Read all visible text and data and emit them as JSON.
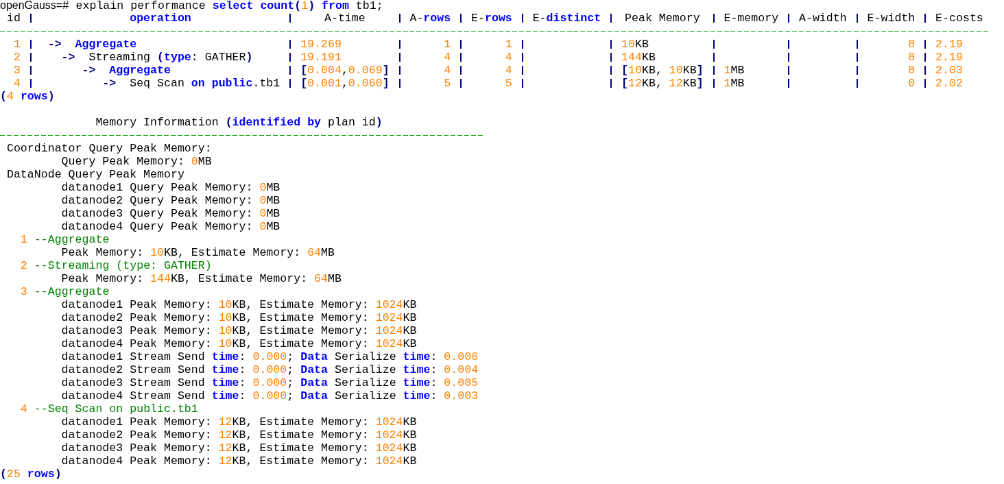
{
  "prompt": {
    "segments": [
      {
        "text": "openGauss=# ",
        "kind": "prompt"
      },
      {
        "text": "explain performance ",
        "kind": "plain"
      },
      {
        "text": "select count",
        "kind": "keyword"
      },
      {
        "text": "(",
        "kind": "operator"
      },
      {
        "text": "1",
        "kind": "number"
      },
      {
        "text": ")",
        "kind": "operator"
      },
      {
        "text": " from",
        "kind": "keyword"
      },
      {
        "text": " tb1;",
        "kind": "plain"
      }
    ]
  },
  "table": {
    "columns": [
      {
        "kind": "numeric",
        "header": [
          {
            "text": "id",
            "kind": "plain"
          }
        ]
      },
      {
        "kind": "text",
        "header": [
          {
            "text": "operation",
            "kind": "keyword"
          }
        ]
      },
      {
        "kind": "text",
        "header": [
          {
            "text": "A-time",
            "kind": "plain"
          }
        ]
      },
      {
        "kind": "numeric",
        "header": [
          {
            "text": "A-",
            "kind": "plain"
          },
          {
            "text": "rows",
            "kind": "keyword"
          }
        ]
      },
      {
        "kind": "numeric",
        "header": [
          {
            "text": "E-",
            "kind": "plain"
          },
          {
            "text": "rows",
            "kind": "keyword"
          }
        ]
      },
      {
        "kind": "numeric",
        "header": [
          {
            "text": "E-",
            "kind": "plain"
          },
          {
            "text": "distinct",
            "kind": "keyword"
          }
        ]
      },
      {
        "kind": "text",
        "header": [
          {
            "text": "Peak Memory",
            "kind": "plain"
          }
        ]
      },
      {
        "kind": "text",
        "header": [
          {
            "text": "E-memory",
            "kind": "plain"
          }
        ]
      },
      {
        "kind": "numeric",
        "header": [
          {
            "text": "A-width",
            "kind": "plain"
          }
        ]
      },
      {
        "kind": "numeric",
        "header": [
          {
            "text": "E-width",
            "kind": "plain"
          }
        ]
      },
      {
        "kind": "text",
        "header": [
          {
            "text": "E-costs",
            "kind": "plain"
          }
        ]
      }
    ],
    "rows": [
      {
        "cells": [
          [
            {
              "text": "1",
              "kind": "number"
            }
          ],
          [
            {
              "text": " ->",
              "kind": "operator"
            },
            {
              "text": "  Aggregate",
              "kind": "keyword"
            }
          ],
          [
            {
              "text": "19.269",
              "kind": "number"
            }
          ],
          [
            {
              "text": "1",
              "kind": "number"
            }
          ],
          [
            {
              "text": "1",
              "kind": "number"
            }
          ],
          null,
          [
            {
              "text": "10",
              "kind": "number"
            },
            {
              "text": "KB",
              "kind": "plain"
            }
          ],
          null,
          null,
          [
            {
              "text": "8",
              "kind": "number"
            }
          ],
          [
            {
              "text": "2.19",
              "kind": "number"
            }
          ]
        ]
      },
      {
        "cells": [
          [
            {
              "text": "2",
              "kind": "number"
            }
          ],
          [
            {
              "text": "   ->",
              "kind": "operator"
            },
            {
              "text": "  Streaming ",
              "kind": "plain"
            },
            {
              "text": "(",
              "kind": "operator"
            },
            {
              "text": "type",
              "kind": "keyword"
            },
            {
              "text": ": GATHER",
              "kind": "plain"
            },
            {
              "text": ")",
              "kind": "operator"
            }
          ],
          [
            {
              "text": "19.191",
              "kind": "number"
            }
          ],
          [
            {
              "text": "4",
              "kind": "number"
            }
          ],
          [
            {
              "text": "4",
              "kind": "number"
            }
          ],
          null,
          [
            {
              "text": "144",
              "kind": "number"
            },
            {
              "text": "KB",
              "kind": "plain"
            }
          ],
          null,
          null,
          [
            {
              "text": "8",
              "kind": "number"
            }
          ],
          [
            {
              "text": "2.19",
              "kind": "number"
            }
          ]
        ]
      },
      {
        "cells": [
          [
            {
              "text": "3",
              "kind": "number"
            }
          ],
          [
            {
              "text": "      ->",
              "kind": "operator"
            },
            {
              "text": "  Aggregate",
              "kind": "keyword"
            }
          ],
          [
            {
              "text": "[",
              "kind": "operator"
            },
            {
              "text": "0.004",
              "kind": "number"
            },
            {
              "text": ",",
              "kind": "plain"
            },
            {
              "text": "0.069",
              "kind": "number"
            },
            {
              "text": "]",
              "kind": "operator"
            }
          ],
          [
            {
              "text": "4",
              "kind": "number"
            }
          ],
          [
            {
              "text": "4",
              "kind": "number"
            }
          ],
          null,
          [
            {
              "text": "[",
              "kind": "operator"
            },
            {
              "text": "10",
              "kind": "number"
            },
            {
              "text": "KB, ",
              "kind": "plain"
            },
            {
              "text": "10",
              "kind": "number"
            },
            {
              "text": "KB",
              "kind": "plain"
            },
            {
              "text": "]",
              "kind": "operator"
            }
          ],
          [
            {
              "text": "1",
              "kind": "number"
            },
            {
              "text": "MB",
              "kind": "plain"
            }
          ],
          null,
          [
            {
              "text": "8",
              "kind": "number"
            }
          ],
          [
            {
              "text": "2.03",
              "kind": "number"
            }
          ]
        ]
      },
      {
        "cells": [
          [
            {
              "text": "4",
              "kind": "number"
            }
          ],
          [
            {
              "text": "         ->",
              "kind": "operator"
            },
            {
              "text": "  Seq Scan ",
              "kind": "plain"
            },
            {
              "text": "on public",
              "kind": "keyword"
            },
            {
              "text": ".tb1",
              "kind": "plain"
            }
          ],
          [
            {
              "text": "[",
              "kind": "operator"
            },
            {
              "text": "0.001",
              "kind": "number"
            },
            {
              "text": ",",
              "kind": "plain"
            },
            {
              "text": "0.060",
              "kind": "number"
            },
            {
              "text": "]",
              "kind": "operator"
            }
          ],
          [
            {
              "text": "5",
              "kind": "number"
            }
          ],
          [
            {
              "text": "5",
              "kind": "number"
            }
          ],
          null,
          [
            {
              "text": "[",
              "kind": "operator"
            },
            {
              "text": "12",
              "kind": "number"
            },
            {
              "text": "KB, ",
              "kind": "plain"
            },
            {
              "text": "12",
              "kind": "number"
            },
            {
              "text": "KB",
              "kind": "plain"
            },
            {
              "text": "]",
              "kind": "operator"
            }
          ],
          [
            {
              "text": "1",
              "kind": "number"
            },
            {
              "text": "MB",
              "kind": "plain"
            }
          ],
          null,
          [
            {
              "text": "0",
              "kind": "number"
            }
          ],
          [
            {
              "text": "2.02",
              "kind": "number"
            }
          ]
        ]
      }
    ],
    "row_count": [
      {
        "text": "(",
        "kind": "operator"
      },
      {
        "text": "4",
        "kind": "number"
      },
      {
        "text": " rows",
        "kind": "keyword"
      },
      {
        "text": ")",
        "kind": "operator"
      }
    ]
  },
  "memory_info": {
    "title": [
      {
        "text": "              Memory Information ",
        "kind": "plain"
      },
      {
        "text": "(",
        "kind": "operator"
      },
      {
        "text": "identified by",
        "kind": "keyword"
      },
      {
        "text": " plan id",
        "kind": "plain"
      },
      {
        "text": ")",
        "kind": "operator"
      }
    ],
    "lines": [
      [
        {
          "text": " Coordinator Query Peak Memory:",
          "kind": "plain"
        }
      ],
      [
        {
          "text": "         Query Peak Memory: ",
          "kind": "plain"
        },
        {
          "text": "0",
          "kind": "number"
        },
        {
          "text": "MB",
          "kind": "plain"
        }
      ],
      [
        {
          "text": " DataNode Query Peak Memory",
          "kind": "plain"
        }
      ],
      [
        {
          "text": "         datanode1 Query Peak Memory: ",
          "kind": "plain"
        },
        {
          "text": "0",
          "kind": "number"
        },
        {
          "text": "MB",
          "kind": "plain"
        }
      ],
      [
        {
          "text": "         datanode2 Query Peak Memory: ",
          "kind": "plain"
        },
        {
          "text": "0",
          "kind": "number"
        },
        {
          "text": "MB",
          "kind": "plain"
        }
      ],
      [
        {
          "text": "         datanode3 Query Peak Memory: ",
          "kind": "plain"
        },
        {
          "text": "0",
          "kind": "number"
        },
        {
          "text": "MB",
          "kind": "plain"
        }
      ],
      [
        {
          "text": "         datanode4 Query Peak Memory: ",
          "kind": "plain"
        },
        {
          "text": "0",
          "kind": "number"
        },
        {
          "text": "MB",
          "kind": "plain"
        }
      ],
      [
        {
          "text": "   1",
          "kind": "number"
        },
        {
          "text": " --Aggregate",
          "kind": "comment"
        }
      ],
      [
        {
          "text": "         Peak Memory: ",
          "kind": "plain"
        },
        {
          "text": "10",
          "kind": "number"
        },
        {
          "text": "KB, Estimate Memory: ",
          "kind": "plain"
        },
        {
          "text": "64",
          "kind": "number"
        },
        {
          "text": "MB",
          "kind": "plain"
        }
      ],
      [
        {
          "text": "   2",
          "kind": "number"
        },
        {
          "text": " --Streaming (type: GATHER)",
          "kind": "comment"
        }
      ],
      [
        {
          "text": "         Peak Memory: ",
          "kind": "plain"
        },
        {
          "text": "144",
          "kind": "number"
        },
        {
          "text": "KB, Estimate Memory: ",
          "kind": "plain"
        },
        {
          "text": "64",
          "kind": "number"
        },
        {
          "text": "MB",
          "kind": "plain"
        }
      ],
      [
        {
          "text": "   3",
          "kind": "number"
        },
        {
          "text": " --Aggregate",
          "kind": "comment"
        }
      ],
      [
        {
          "text": "         datanode1 Peak Memory: ",
          "kind": "plain"
        },
        {
          "text": "10",
          "kind": "number"
        },
        {
          "text": "KB, Estimate Memory: ",
          "kind": "plain"
        },
        {
          "text": "1024",
          "kind": "number"
        },
        {
          "text": "KB",
          "kind": "plain"
        }
      ],
      [
        {
          "text": "         datanode2 Peak Memory: ",
          "kind": "plain"
        },
        {
          "text": "10",
          "kind": "number"
        },
        {
          "text": "KB, Estimate Memory: ",
          "kind": "plain"
        },
        {
          "text": "1024",
          "kind": "number"
        },
        {
          "text": "KB",
          "kind": "plain"
        }
      ],
      [
        {
          "text": "         datanode3 Peak Memory: ",
          "kind": "plain"
        },
        {
          "text": "10",
          "kind": "number"
        },
        {
          "text": "KB, Estimate Memory: ",
          "kind": "plain"
        },
        {
          "text": "1024",
          "kind": "number"
        },
        {
          "text": "KB",
          "kind": "plain"
        }
      ],
      [
        {
          "text": "         datanode4 Peak Memory: ",
          "kind": "plain"
        },
        {
          "text": "10",
          "kind": "number"
        },
        {
          "text": "KB, Estimate Memory: ",
          "kind": "plain"
        },
        {
          "text": "1024",
          "kind": "number"
        },
        {
          "text": "KB",
          "kind": "plain"
        }
      ],
      [
        {
          "text": "         datanode1 Stream Send ",
          "kind": "plain"
        },
        {
          "text": "time",
          "kind": "keyword"
        },
        {
          "text": ": ",
          "kind": "plain"
        },
        {
          "text": "0.000",
          "kind": "number"
        },
        {
          "text": "; ",
          "kind": "plain"
        },
        {
          "text": "Data",
          "kind": "keyword"
        },
        {
          "text": " Serialize ",
          "kind": "plain"
        },
        {
          "text": "time",
          "kind": "keyword"
        },
        {
          "text": ": ",
          "kind": "plain"
        },
        {
          "text": "0.006",
          "kind": "number"
        }
      ],
      [
        {
          "text": "         datanode2 Stream Send ",
          "kind": "plain"
        },
        {
          "text": "time",
          "kind": "keyword"
        },
        {
          "text": ": ",
          "kind": "plain"
        },
        {
          "text": "0.000",
          "kind": "number"
        },
        {
          "text": "; ",
          "kind": "plain"
        },
        {
          "text": "Data",
          "kind": "keyword"
        },
        {
          "text": " Serialize ",
          "kind": "plain"
        },
        {
          "text": "time",
          "kind": "keyword"
        },
        {
          "text": ": ",
          "kind": "plain"
        },
        {
          "text": "0.004",
          "kind": "number"
        }
      ],
      [
        {
          "text": "         datanode3 Stream Send ",
          "kind": "plain"
        },
        {
          "text": "time",
          "kind": "keyword"
        },
        {
          "text": ": ",
          "kind": "plain"
        },
        {
          "text": "0.000",
          "kind": "number"
        },
        {
          "text": "; ",
          "kind": "plain"
        },
        {
          "text": "Data",
          "kind": "keyword"
        },
        {
          "text": " Serialize ",
          "kind": "plain"
        },
        {
          "text": "time",
          "kind": "keyword"
        },
        {
          "text": ": ",
          "kind": "plain"
        },
        {
          "text": "0.005",
          "kind": "number"
        }
      ],
      [
        {
          "text": "         datanode4 Stream Send ",
          "kind": "plain"
        },
        {
          "text": "time",
          "kind": "keyword"
        },
        {
          "text": ": ",
          "kind": "plain"
        },
        {
          "text": "0.000",
          "kind": "number"
        },
        {
          "text": "; ",
          "kind": "plain"
        },
        {
          "text": "Data",
          "kind": "keyword"
        },
        {
          "text": " Serialize ",
          "kind": "plain"
        },
        {
          "text": "time",
          "kind": "keyword"
        },
        {
          "text": ": ",
          "kind": "plain"
        },
        {
          "text": "0.003",
          "kind": "number"
        }
      ],
      [
        {
          "text": "   4",
          "kind": "number"
        },
        {
          "text": " --Seq Scan on public.tb1",
          "kind": "comment"
        }
      ],
      [
        {
          "text": "         datanode1 Peak Memory: ",
          "kind": "plain"
        },
        {
          "text": "12",
          "kind": "number"
        },
        {
          "text": "KB, Estimate Memory: ",
          "kind": "plain"
        },
        {
          "text": "1024",
          "kind": "number"
        },
        {
          "text": "KB",
          "kind": "plain"
        }
      ],
      [
        {
          "text": "         datanode2 Peak Memory: ",
          "kind": "plain"
        },
        {
          "text": "12",
          "kind": "number"
        },
        {
          "text": "KB, Estimate Memory: ",
          "kind": "plain"
        },
        {
          "text": "1024",
          "kind": "number"
        },
        {
          "text": "KB",
          "kind": "plain"
        }
      ],
      [
        {
          "text": "         datanode3 Peak Memory: ",
          "kind": "plain"
        },
        {
          "text": "12",
          "kind": "number"
        },
        {
          "text": "KB, Estimate Memory: ",
          "kind": "plain"
        },
        {
          "text": "1024",
          "kind": "number"
        },
        {
          "text": "KB",
          "kind": "plain"
        }
      ],
      [
        {
          "text": "         datanode4 Peak Memory: ",
          "kind": "plain"
        },
        {
          "text": "12",
          "kind": "number"
        },
        {
          "text": "KB, Estimate Memory: ",
          "kind": "plain"
        },
        {
          "text": "1024",
          "kind": "number"
        },
        {
          "text": "KB",
          "kind": "plain"
        }
      ]
    ],
    "row_count": [
      {
        "text": "(",
        "kind": "operator"
      },
      {
        "text": "25",
        "kind": "number"
      },
      {
        "text": " rows",
        "kind": "keyword"
      },
      {
        "text": ")",
        "kind": "operator"
      }
    ]
  }
}
